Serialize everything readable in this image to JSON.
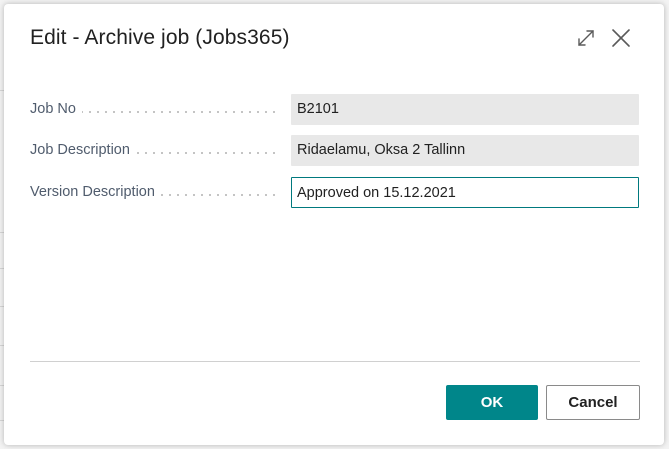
{
  "dialog": {
    "title": "Edit - Archive job (Jobs365)"
  },
  "fields": [
    {
      "label": "Job No",
      "value": "B2101",
      "editable": false
    },
    {
      "label": "Job Description",
      "value": "Ridaelamu, Oksa 2 Tallinn",
      "editable": false
    },
    {
      "label": "Version Description",
      "value": "Approved on 15.12.2021",
      "editable": true
    }
  ],
  "buttons": {
    "ok_label": "OK",
    "cancel_label": "Cancel"
  },
  "icons": {
    "expand": "expand-icon",
    "close": "close-icon"
  },
  "colors": {
    "accent": "#00868a",
    "focus_border": "#00797e",
    "readonly_bg": "#e8e8e8"
  }
}
